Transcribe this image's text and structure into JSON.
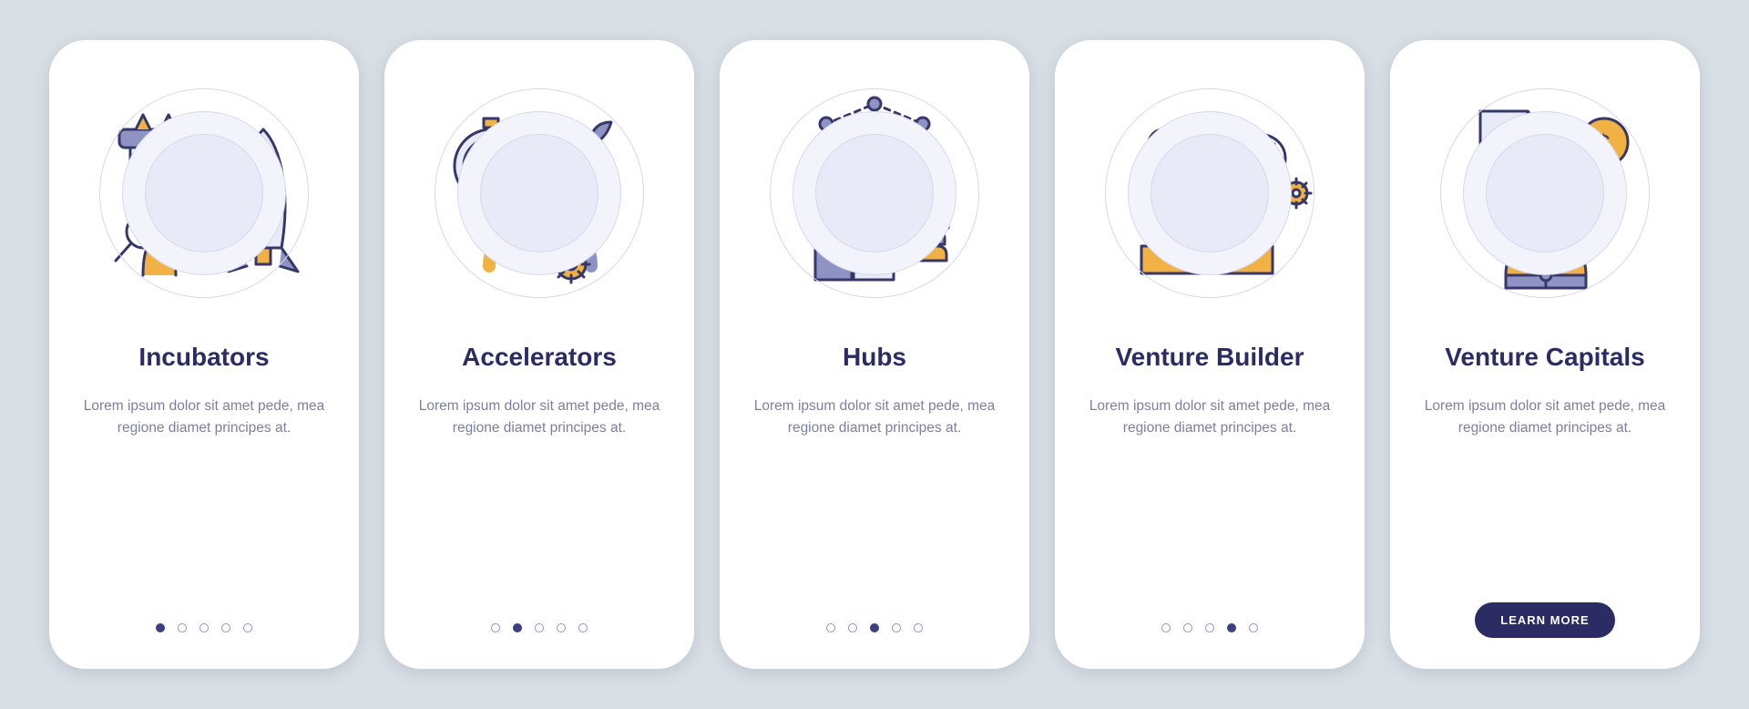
{
  "cta_label": "LEARN MORE",
  "colors": {
    "indigo": "#2a2c63",
    "lavender": "#8f93c4",
    "amber": "#f1b243",
    "outline": "#36376a",
    "soft": "#e9eaf7"
  },
  "cards": [
    {
      "id": "incubators",
      "title": "Incubators",
      "desc": "Lorem ipsum dolor sit amet pede, mea regione diamet principes at.",
      "icon": "rocket-research-icon",
      "active_dot": 0
    },
    {
      "id": "accelerators",
      "title": "Accelerators",
      "desc": "Lorem ipsum dolor sit amet pede, mea regione diamet principes at.",
      "icon": "speed-growth-icon",
      "active_dot": 1
    },
    {
      "id": "hubs",
      "title": "Hubs",
      "desc": "Lorem ipsum dolor sit amet pede, mea regione diamet principes at.",
      "icon": "network-city-icon",
      "active_dot": 2
    },
    {
      "id": "venture-builder",
      "title": "Venture Builder",
      "desc": "Lorem ipsum dolor sit amet pede, mea regione diamet principes at.",
      "icon": "team-build-icon",
      "active_dot": 3
    },
    {
      "id": "venture-capitals",
      "title": "Venture Capitals",
      "desc": "Lorem ipsum dolor sit amet pede, mea regione diamet principes at.",
      "icon": "handshake-money-icon",
      "active_dot": 4
    }
  ]
}
